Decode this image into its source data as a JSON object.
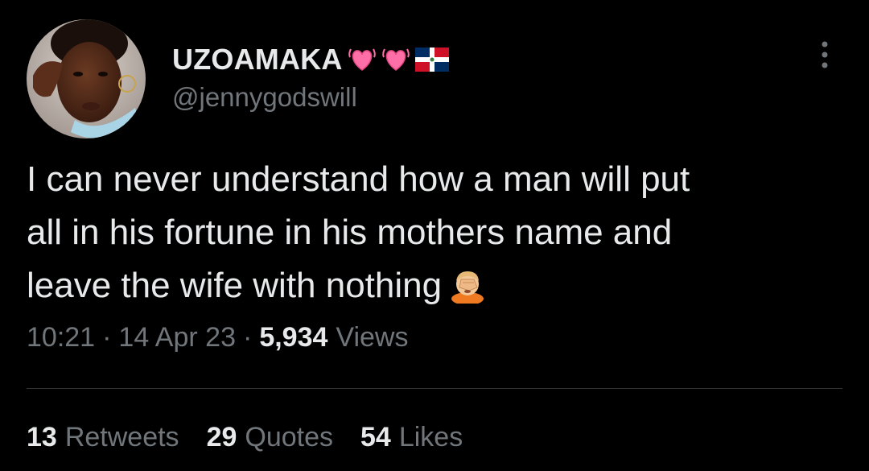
{
  "colors": {
    "background": "#000000",
    "primary_text": "#e7e9ea",
    "secondary_text": "#71767b",
    "divider": "#2f3336",
    "heart": "#ff6fa7"
  },
  "author": {
    "display_name": "UZOAMAKA",
    "name_emojis": [
      "growing-heart-icon",
      "growing-heart-icon",
      "dominican-republic-flag-icon"
    ],
    "handle": "@jennygodswill",
    "avatar_icon": "profile-photo"
  },
  "tweet": {
    "lines": [
      "I can never understand how a man will put",
      "all in his fortune in his mothers name and",
      "leave the wife with nothing"
    ],
    "trailing_emoji": "face-palm-icon"
  },
  "meta": {
    "time": "10:21",
    "separator": "·",
    "date": "14 Apr 23",
    "views_count": "5,934",
    "views_label": "Views"
  },
  "stats": [
    {
      "count": "13",
      "label": "Retweets"
    },
    {
      "count": "29",
      "label": "Quotes"
    },
    {
      "count": "54",
      "label": "Likes"
    }
  ],
  "more_icon": "more-options-icon"
}
